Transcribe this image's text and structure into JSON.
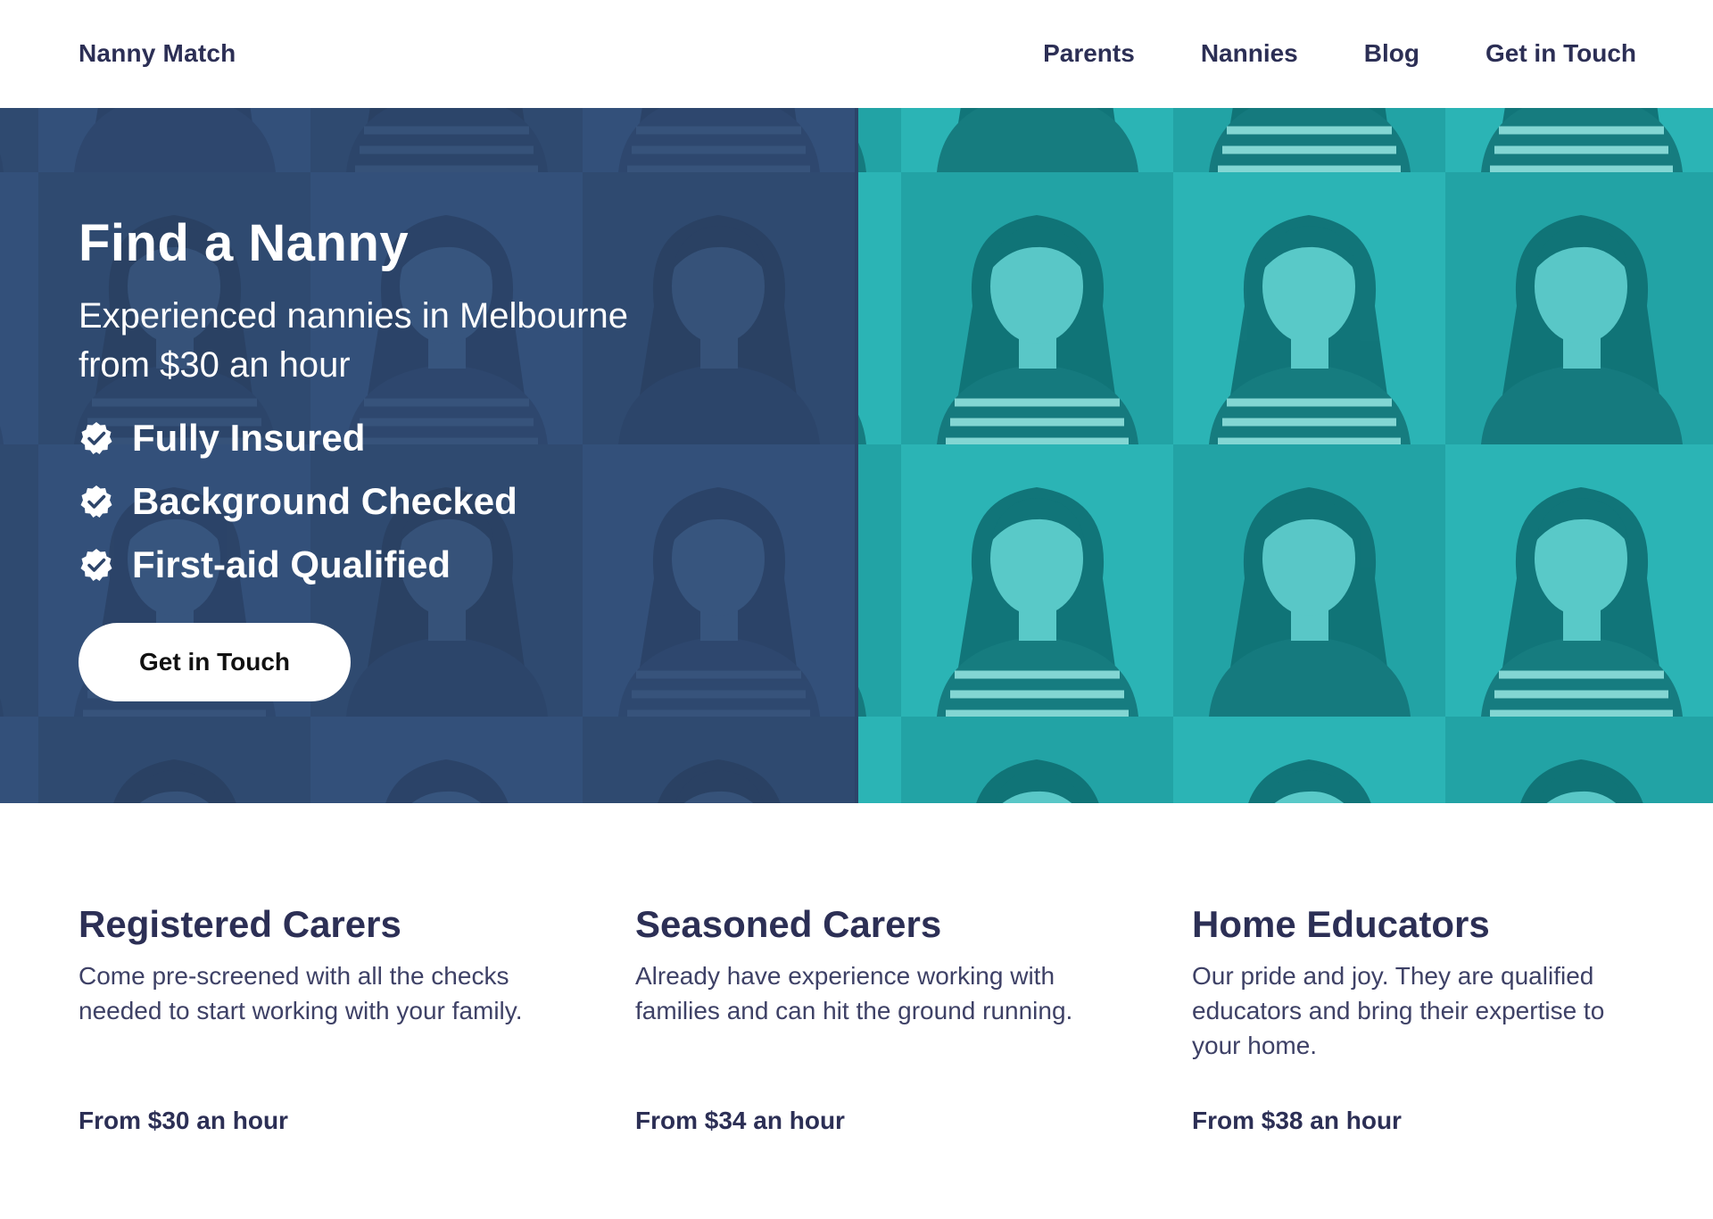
{
  "header": {
    "logo": "Nanny Match",
    "nav": [
      {
        "label": "Parents"
      },
      {
        "label": "Nannies"
      },
      {
        "label": "Blog"
      },
      {
        "label": "Get in Touch"
      }
    ]
  },
  "hero": {
    "title": "Find a Nanny",
    "subtitle": "Experienced nannies in Melbourne from $30 an hour",
    "features": [
      {
        "label": "Fully Insured",
        "icon": "verified-check-icon"
      },
      {
        "label": "Background Checked",
        "icon": "verified-check-icon"
      },
      {
        "label": "First-aid Qualified",
        "icon": "verified-check-icon"
      }
    ],
    "cta_label": "Get in Touch",
    "colors": {
      "navy_panel": "#2d4469",
      "teal_panel": "#1ea9ab"
    }
  },
  "cards": [
    {
      "title": "Registered Carers",
      "description": "Come pre-screened with all the checks needed to start working with your family.",
      "price": "From $30 an hour"
    },
    {
      "title": "Seasoned Carers",
      "description": "Already have experience working with families and can hit the ground running.",
      "price": "From $34 an hour"
    },
    {
      "title": "Home Educators",
      "description": "Our pride and joy. They are qualified educators and bring their expertise to your home.",
      "price": "From $38 an hour"
    }
  ]
}
